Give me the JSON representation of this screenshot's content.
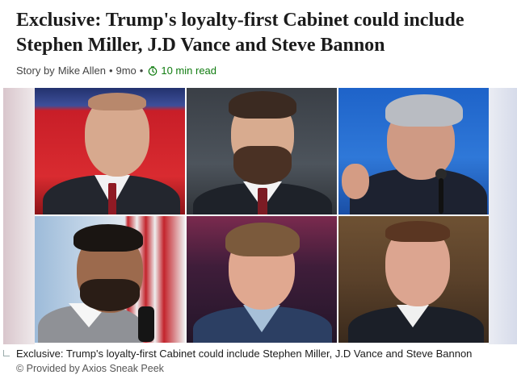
{
  "article": {
    "headline": "Exclusive: Trump's loyalty-first Cabinet could include Stephen Miller, J.D Vance and Steve Bannon",
    "byline": {
      "prefix": "Story by",
      "author": "Mike Allen",
      "separator": "•",
      "age": "9mo",
      "read_time": "10 min read",
      "read_time_color": "#107c10",
      "icon": "clock-icon"
    }
  },
  "image": {
    "caption": "Exclusive: Trump's loyalty-first Cabinet could include Stephen Miller, J.D Vance and Steve Bannon",
    "credit": "© Provided by Axios Sneak Peek"
  }
}
